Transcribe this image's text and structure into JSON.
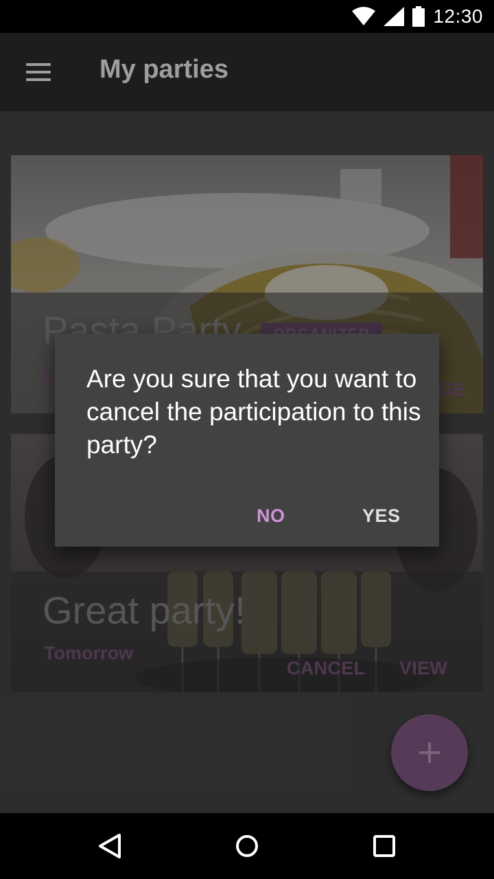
{
  "status_bar": {
    "time": "12:30",
    "icons": [
      "wifi-icon",
      "signal-icon",
      "battery-icon"
    ]
  },
  "app_bar": {
    "title": "My parties",
    "menu_icon": "menu-icon"
  },
  "cards": [
    {
      "title": "Pasta Party",
      "badge": "ORGANIZER",
      "date": "To",
      "action": "GE",
      "image": "pasta-photo"
    },
    {
      "title": "Great party!",
      "date": "Tomorrow",
      "actions": [
        "CANCEL",
        "VIEW"
      ],
      "image": "champagne-glasses-photo"
    }
  ],
  "dialog": {
    "message": "Are you sure that you want to cancel the participation to this party?",
    "negative_label": "NO",
    "positive_label": "YES"
  },
  "fab": {
    "icon": "plus-icon"
  },
  "nav_bar": {
    "icons": [
      "back-icon",
      "home-icon",
      "recents-icon"
    ]
  },
  "colors": {
    "accent": "#ce93d8",
    "app_bar": "#303030",
    "dialog": "#424242"
  }
}
